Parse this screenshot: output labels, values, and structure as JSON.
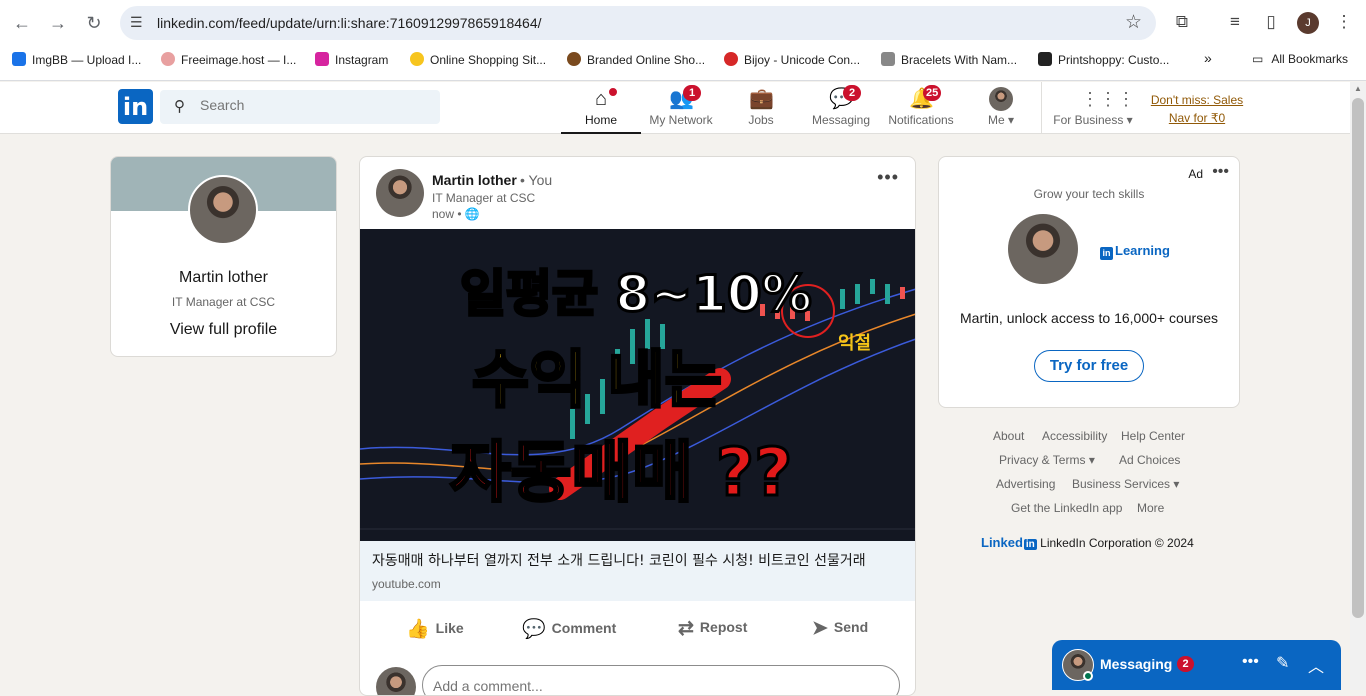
{
  "browser": {
    "url": "linkedin.com/feed/update/urn:li:share:7160912997865918464/",
    "profile_initial": "J",
    "all_bookmarks": "All Bookmarks",
    "bookmarks": [
      {
        "label": "ImgBB — Upload I...",
        "color": "#1a73e8"
      },
      {
        "label": "Freeimage.host — I...",
        "color": "#e8a0a0"
      },
      {
        "label": "Instagram",
        "color": "#d6249f"
      },
      {
        "label": "Online Shopping Sit...",
        "color": "#f7c51e"
      },
      {
        "label": "Branded Online Sho...",
        "color": "#7a4a1e"
      },
      {
        "label": "Bijoy - Unicode Con...",
        "color": "#d62828"
      },
      {
        "label": "Bracelets With Nam...",
        "color": "#888888"
      },
      {
        "label": "Printshoppy: Custo...",
        "color": "#222222"
      }
    ]
  },
  "nav": {
    "search_placeholder": "Search",
    "items": [
      {
        "label": "Home"
      },
      {
        "label": "My Network",
        "badge": "1"
      },
      {
        "label": "Jobs"
      },
      {
        "label": "Messaging",
        "badge": "2"
      },
      {
        "label": "Notifications",
        "badge": "25"
      },
      {
        "label": "Me"
      }
    ],
    "for_business": "For Business",
    "promo_line1": "Don't miss: Sales",
    "promo_line2": "Nav for ₹0"
  },
  "profile": {
    "name": "Martin lother",
    "title": "IT Manager at CSC",
    "view_profile": "View full profile"
  },
  "post": {
    "author": "Martin lother",
    "you": "• You",
    "headline": "IT Manager at CSC",
    "time": "now •",
    "thumb_line1": "일평균 8~10%",
    "thumb_line2": "수익 내는",
    "thumb_line3": "자동매매 ??",
    "thumb_label": "익절",
    "link_title": "자동매매 하나부터 열까지 전부 소개 드립니다! 코린이 필수 시청! 비트코인 선물거래",
    "link_domain": "youtube.com",
    "actions": {
      "like": "Like",
      "comment": "Comment",
      "repost": "Repost",
      "send": "Send"
    },
    "comment_placeholder": "Add a comment..."
  },
  "ad": {
    "label": "Ad",
    "grow": "Grow your tech skills",
    "brand": "Learning",
    "offer": "Martin, unlock access to 16,000+ courses",
    "cta": "Try for free"
  },
  "footer": {
    "about": "About",
    "accessibility": "Accessibility",
    "help": "Help Center",
    "privacy": "Privacy & Terms",
    "adchoices": "Ad Choices",
    "advertising": "Advertising",
    "business": "Business Services",
    "app": "Get the LinkedIn app",
    "more": "More",
    "brand": "Linked",
    "copyright": "LinkedIn Corporation © 2024"
  },
  "messaging": {
    "title": "Messaging",
    "badge": "2"
  }
}
